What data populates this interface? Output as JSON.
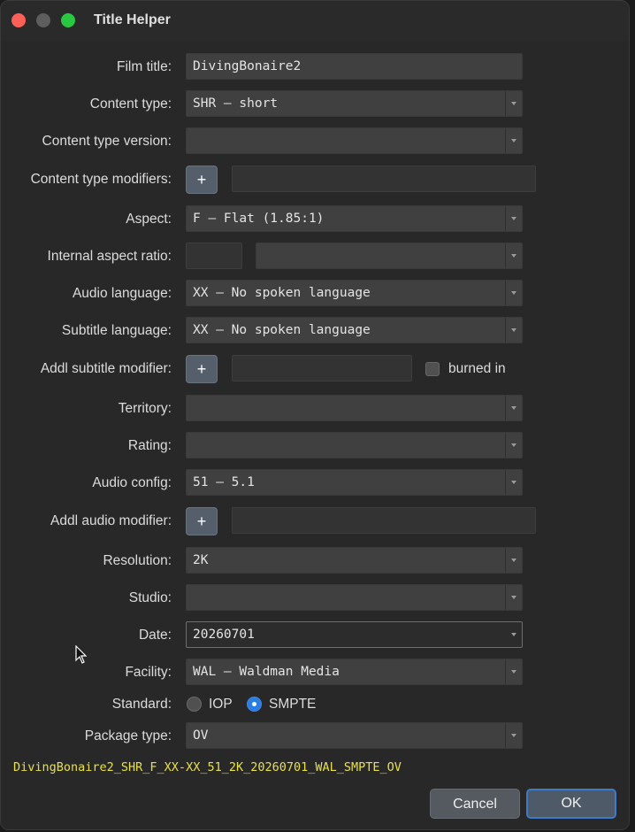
{
  "window": {
    "title": "Title Helper"
  },
  "form": {
    "film_title": {
      "label": "Film title:",
      "value": "DivingBonaire2"
    },
    "content_type": {
      "label": "Content type:",
      "value": "SHR – short"
    },
    "content_type_version": {
      "label": "Content type version:",
      "value": ""
    },
    "content_type_modifiers": {
      "label": "Content type modifiers:",
      "button": "+",
      "value": ""
    },
    "aspect": {
      "label": "Aspect:",
      "value": "F – Flat (1.85:1)"
    },
    "internal_aspect_ratio": {
      "label": "Internal aspect ratio:",
      "value": "",
      "combo_value": ""
    },
    "audio_language": {
      "label": "Audio language:",
      "value": "XX – No spoken language"
    },
    "subtitle_language": {
      "label": "Subtitle language:",
      "value": "XX – No spoken language"
    },
    "addl_subtitle_modifier": {
      "label": "Addl subtitle modifier:",
      "button": "+",
      "value": "",
      "checkbox_label": "burned in",
      "checked": false
    },
    "territory": {
      "label": "Territory:",
      "value": ""
    },
    "rating": {
      "label": "Rating:",
      "value": ""
    },
    "audio_config": {
      "label": "Audio config:",
      "value": "51 – 5.1"
    },
    "addl_audio_modifier": {
      "label": "Addl audio modifier:",
      "button": "+",
      "value": ""
    },
    "resolution": {
      "label": "Resolution:",
      "value": "2K"
    },
    "studio": {
      "label": "Studio:",
      "value": ""
    },
    "date": {
      "label": "Date:",
      "value": "20260701"
    },
    "facility": {
      "label": "Facility:",
      "value": "WAL – Waldman Media"
    },
    "standard": {
      "label": "Standard:",
      "option_iop": "IOP",
      "option_smpte": "SMPTE",
      "selected": "SMPTE"
    },
    "package_type": {
      "label": "Package type:",
      "value": "OV"
    }
  },
  "summary": "DivingBonaire2_SHR_F_XX-XX_51_2K_20260701_WAL_SMPTE_OV",
  "buttons": {
    "cancel": "Cancel",
    "ok": "OK"
  },
  "colors": {
    "summary_text": "#e8e04a",
    "radio_selected": "#2b7de1",
    "ok_border": "#3d7bc9"
  }
}
